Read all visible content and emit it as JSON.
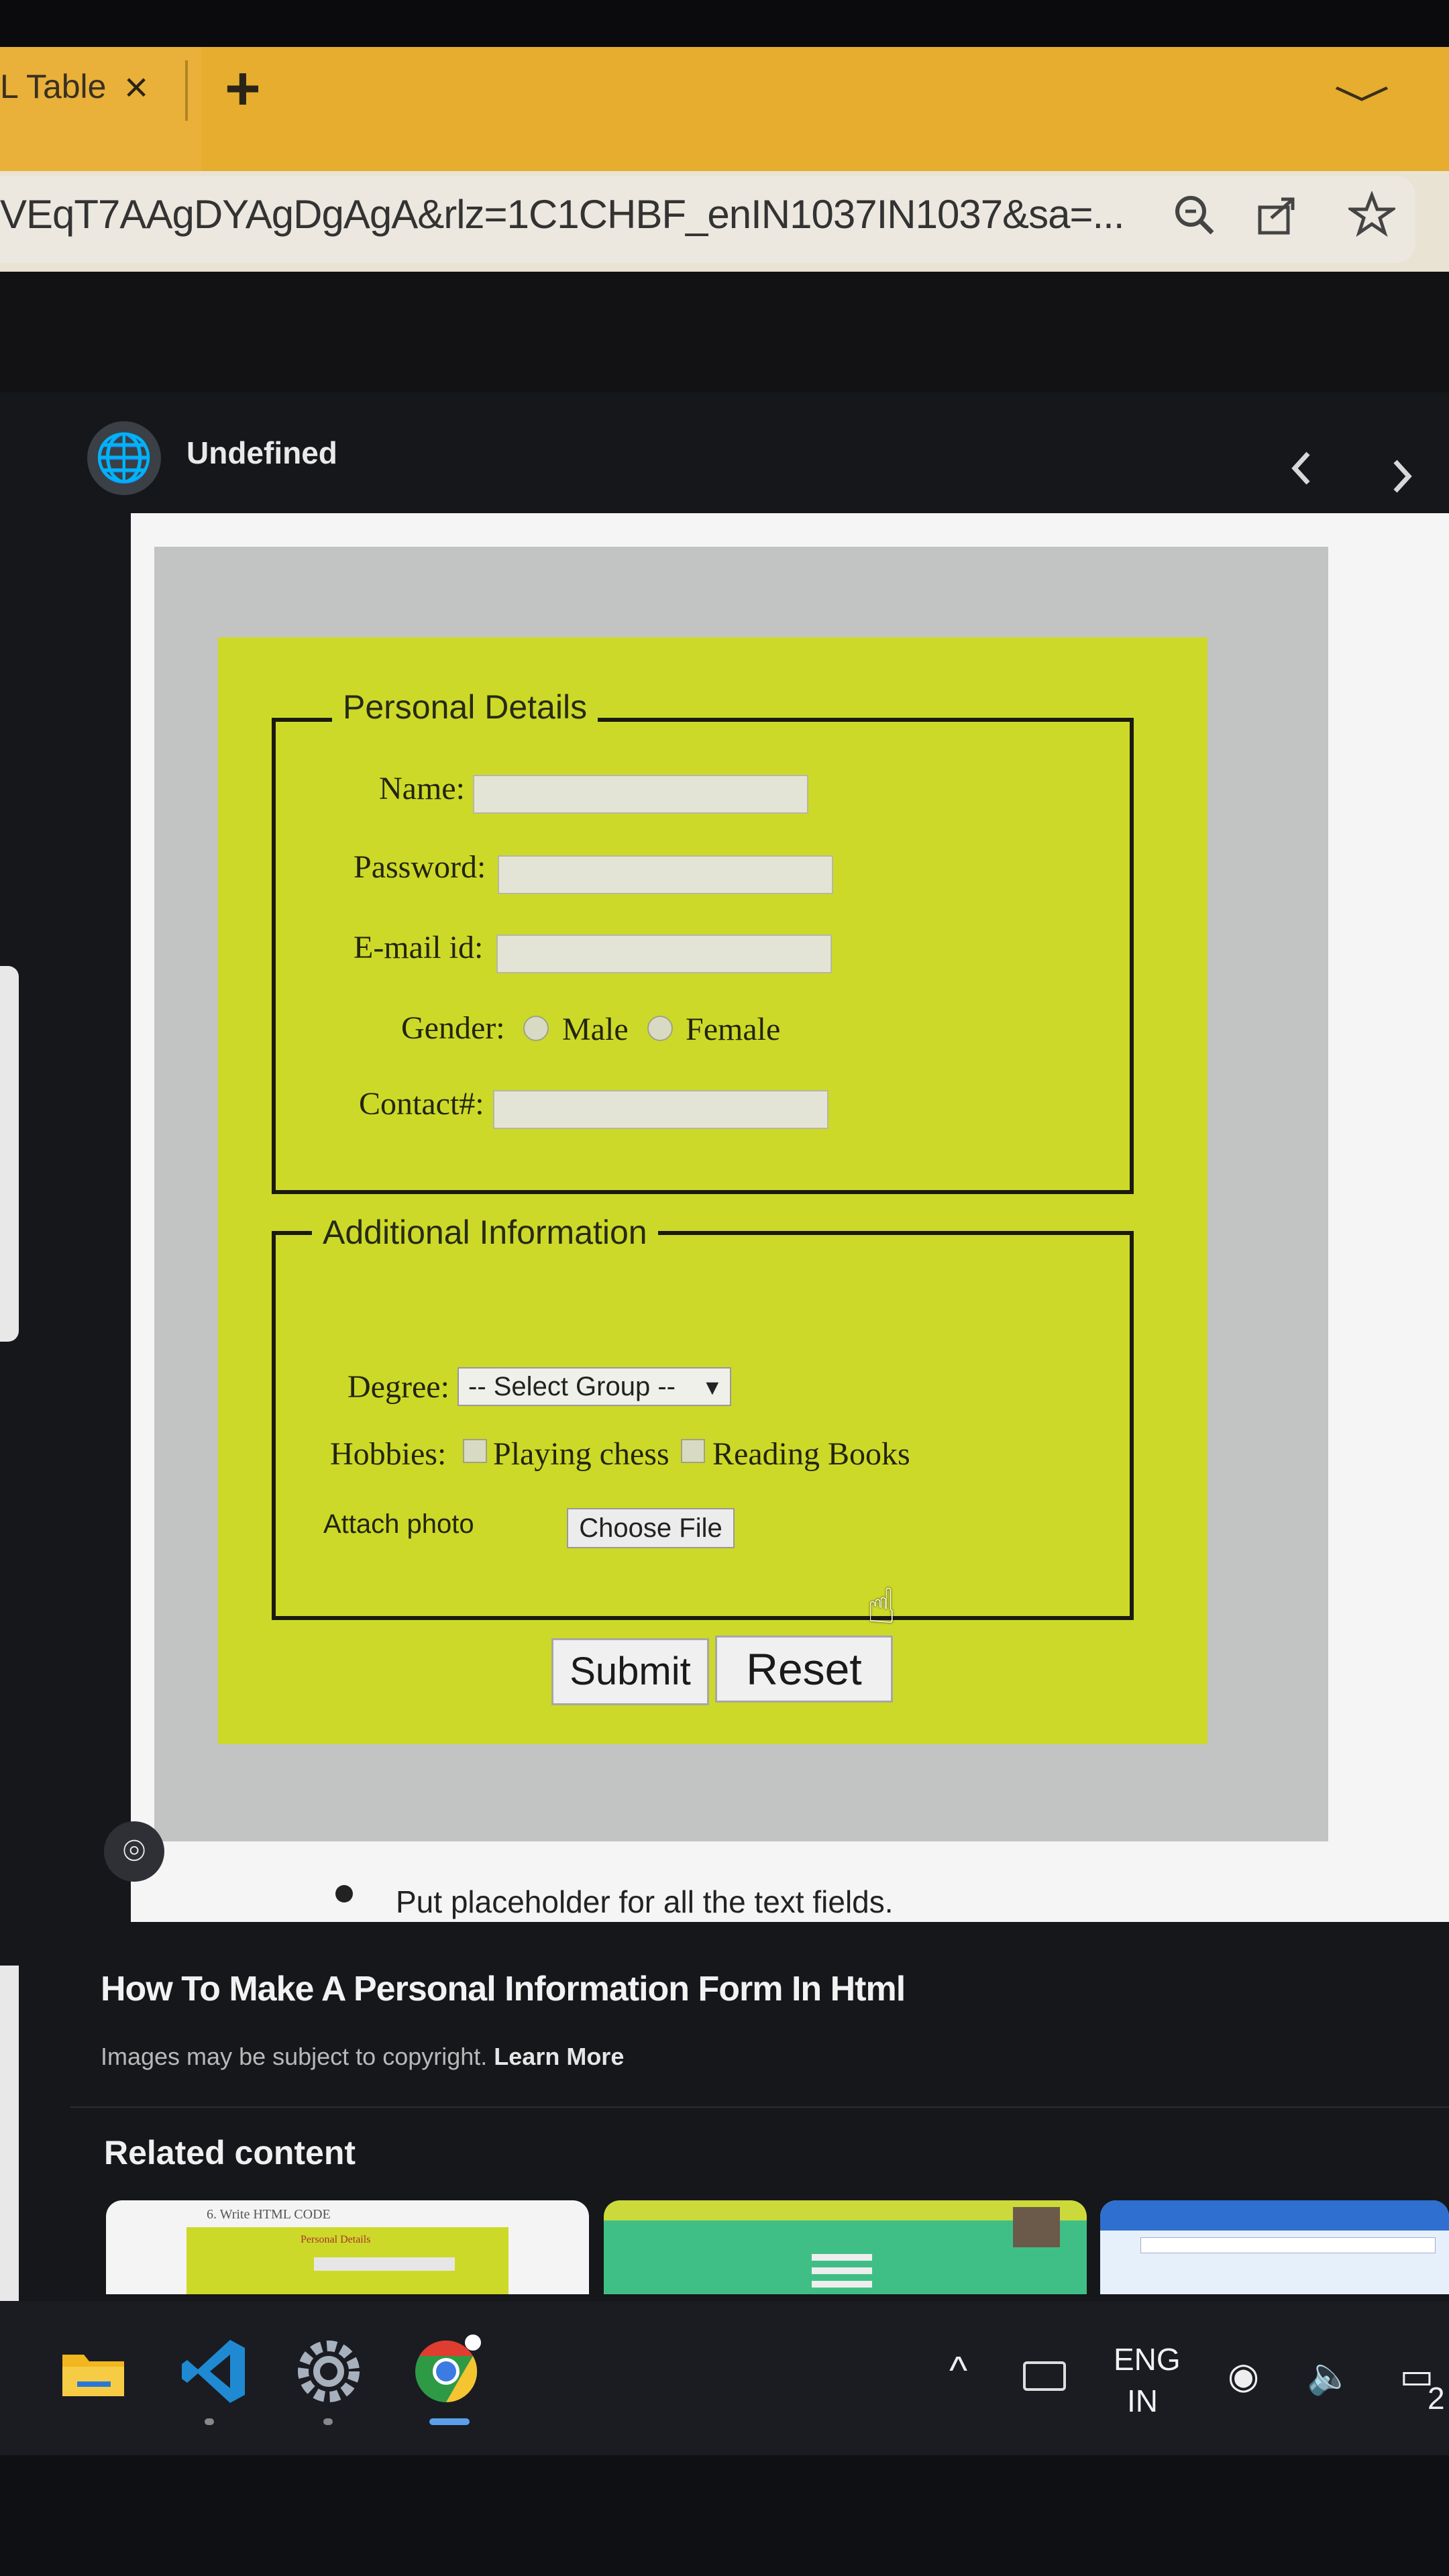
{
  "browser": {
    "tab_title": "L Table",
    "close_glyph": "×",
    "new_tab_glyph": "+",
    "tab_list_glyph": "﹀",
    "url": "VEqT7AAgDYAgDgAgA&rlz=1C1CHBF_enIN1037IN1037&sa=...",
    "icons": [
      "zoom-icon",
      "share-icon",
      "star-icon"
    ]
  },
  "viewer": {
    "site_name": "Undefined",
    "globe_glyph": "🌐",
    "prev_glyph": "‹",
    "next_glyph": "›",
    "lens_glyph": "⌾",
    "image_title": "How To Make A Personal Information Form In Html",
    "copyright": "Images may be subject to copyright.",
    "learn_more": "Learn More",
    "related_heading": "Related content"
  },
  "form": {
    "personal_legend": "Personal Details",
    "name_label": "Name:",
    "password_label": "Password:",
    "email_label": "E-mail id:",
    "gender_label": "Gender:",
    "gender_options": [
      "Male",
      "Female"
    ],
    "contact_label": "Contact#:",
    "additional_legend": "Additional Information",
    "degree_label": "Degree:",
    "degree_value": "-- Select Group --",
    "hobbies_label": "Hobbies:",
    "hobby_options": [
      "Playing chess",
      "Reading Books"
    ],
    "photo_label": "Attach photo",
    "choose_file": "Choose File",
    "submit": "Submit",
    "reset": "Reset",
    "bullet_text": "Put placeholder for all the text fields."
  },
  "related_thumbs": [
    {
      "caption": "6. Write HTML CODE",
      "subcaption": "Personal Details"
    },
    {
      "caption": ""
    },
    {
      "caption": ""
    }
  ],
  "taskbar": {
    "apps": [
      "file-explorer-icon",
      "vscode-icon",
      "settings-icon",
      "chrome-icon"
    ],
    "lang_line1": "ENG",
    "lang_line2": "IN",
    "caret_glyph": "^",
    "tray_glyphs": "◉ 🔈 ▭",
    "clock": "2"
  },
  "colors": {
    "tab_bar": "#e6ad2e",
    "form_background": "#cdd928",
    "panel_gray": "#c2c4c3",
    "vscode_blue": "#1f8ad2",
    "chrome_green": "#2f9a45"
  }
}
